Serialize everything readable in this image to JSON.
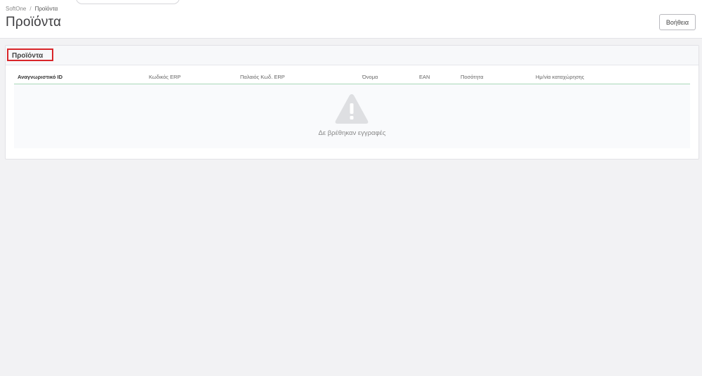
{
  "breadcrumb": {
    "root": "SoftOne",
    "separator": "/",
    "current": "Προϊόντα"
  },
  "page": {
    "title": "Προϊόντα",
    "help_label": "Βοήθεια"
  },
  "card": {
    "title": "Προϊόντα"
  },
  "table": {
    "columns": [
      "Αναγνωριστικό ID",
      "Κωδικός ERP",
      "Παλαιός Κωδ. ERP",
      "Όνομα",
      "EAN",
      "Ποσότητα",
      "Ημ/νία καταχώρησης"
    ],
    "empty_message": "Δε βρέθηκαν εγγραφές"
  },
  "icons": {
    "empty_state": "warning-triangle-icon"
  },
  "colors": {
    "highlight_border": "#d9262a",
    "header_divider": "#a8d8b8"
  }
}
